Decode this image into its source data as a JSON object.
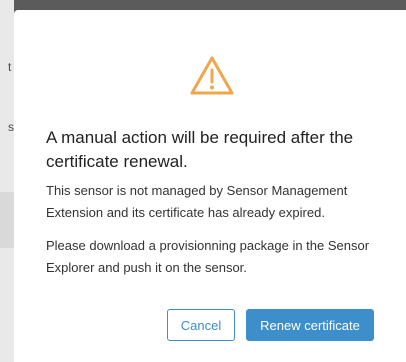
{
  "background": {
    "char_top": "t",
    "char_mid": "s"
  },
  "dialog": {
    "icon": "warning-triangle-icon",
    "icon_color": "#f0a64a",
    "title": "A manual action will be required after the certificate renewal.",
    "paragraph_1": "This sensor is not managed by Sensor Management Extension and its certificate has already expired.",
    "paragraph_2": "Please download a provisionning package in the Sensor Explorer and push it on the sensor.",
    "cancel_label": "Cancel",
    "renew_label": "Renew certificate",
    "accent_color": "#3d8fcb"
  }
}
